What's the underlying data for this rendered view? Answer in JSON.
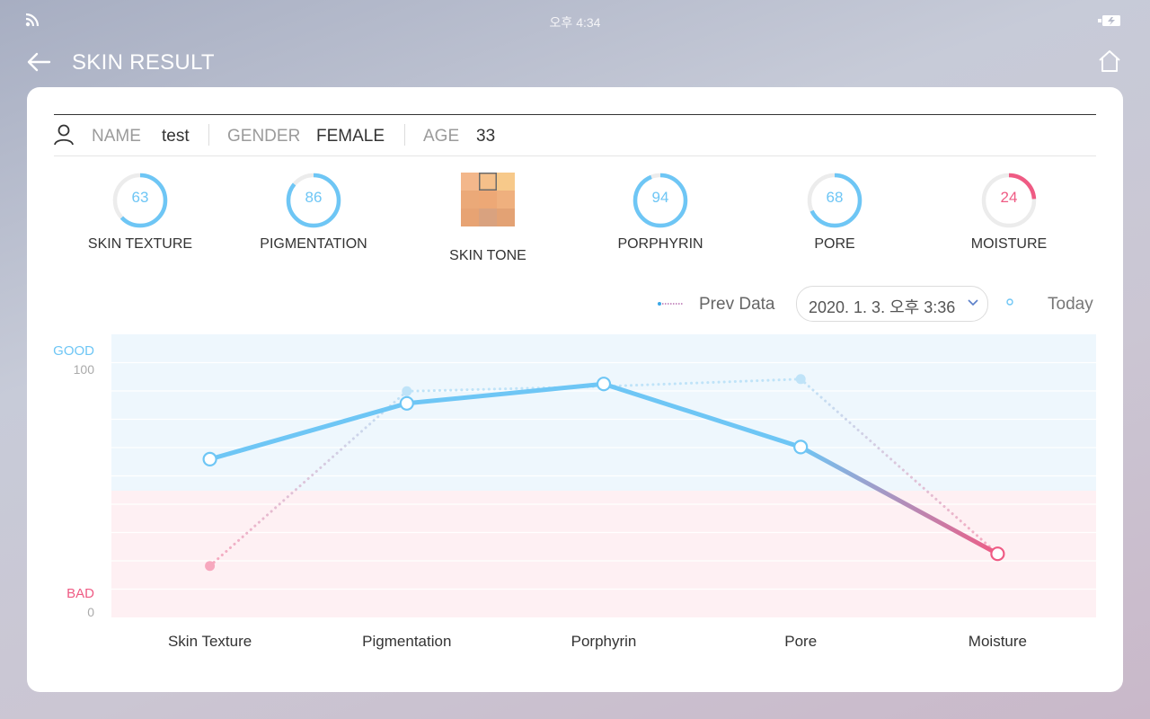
{
  "status_bar": {
    "time": "오후 4:34",
    "wifi_icon": "wifi-icon",
    "battery_icon": "battery-charging-icon"
  },
  "header": {
    "title": "SKIN RESULT",
    "back_icon": "arrow-left-icon",
    "home_icon": "home-icon"
  },
  "user_info": {
    "name_label": "NAME",
    "name_value": "test",
    "gender_label": "GENDER",
    "gender_value": "FEMALE",
    "age_label": "AGE",
    "age_value": "33"
  },
  "metrics": [
    {
      "label": "SKIN TEXTURE",
      "value": 63,
      "color": "#6ec6f5"
    },
    {
      "label": "PIGMENTATION",
      "value": 86,
      "color": "#6ec6f5"
    },
    {
      "label": "SKIN TONE"
    },
    {
      "label": "PORPHYRIN",
      "value": 94,
      "color": "#6ec6f5"
    },
    {
      "label": "PORE",
      "value": 68,
      "color": "#6ec6f5"
    },
    {
      "label": "MOISTURE",
      "value": 24,
      "color": "#ef5b84"
    }
  ],
  "skin_tone_palette": [
    "#f3b78b",
    "#f5c08a",
    "#f7c98a",
    "#eba978",
    "#eda876",
    "#efb07e",
    "#e7a373",
    "#d9a27f",
    "#e3a274"
  ],
  "skin_tone_selected_index": 1,
  "legend": {
    "prev_label": "Prev Data",
    "today_label": "Today",
    "date_selected": "2020. 1. 3. 오후 3:36"
  },
  "colors": {
    "good": "#6ec6f5",
    "bad": "#ef5b84",
    "prev_good": "#bfe3f8",
    "prev_bad": "#f7a8be"
  },
  "chart_data": {
    "type": "line",
    "categories": [
      "Skin Texture",
      "Pigmentation",
      "Porphyrin",
      "Pore",
      "Moisture"
    ],
    "series": [
      {
        "name": "Prev Data",
        "values": [
          19,
          91,
          93,
          96,
          24
        ]
      },
      {
        "name": "Today",
        "values": [
          63,
          86,
          94,
          68,
          24
        ]
      }
    ],
    "ylim": [
      0,
      100
    ],
    "y_ticks": [
      0,
      100
    ],
    "good_label": "GOOD",
    "bad_label": "BAD",
    "threshold": 50
  }
}
